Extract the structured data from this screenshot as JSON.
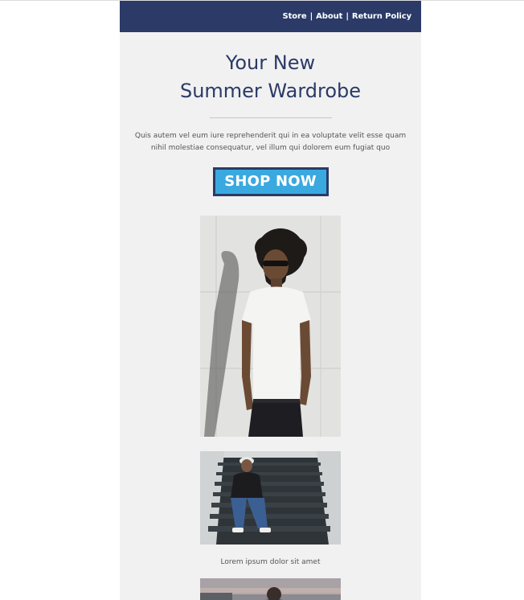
{
  "nav": {
    "store": "Store",
    "about": "About",
    "return_policy": "Return Policy",
    "separator": "|"
  },
  "hero": {
    "title_line1": "Your New",
    "title_line2": "Summer Wardrobe",
    "body": "Quis autem vel eum iure reprehenderit qui in ea voluptate velit esse quam nihil molestiae consequatur, vel illum qui dolorem eum fugiat quo",
    "cta_label": "SHOP NOW"
  },
  "gallery": {
    "caption": "Lorem ipsum dolor sit amet"
  },
  "colors": {
    "header_bg": "#2b3a67",
    "page_bg": "#f1f1f1",
    "button_bg": "#3aa9e0",
    "title_text": "#2b3a67"
  }
}
